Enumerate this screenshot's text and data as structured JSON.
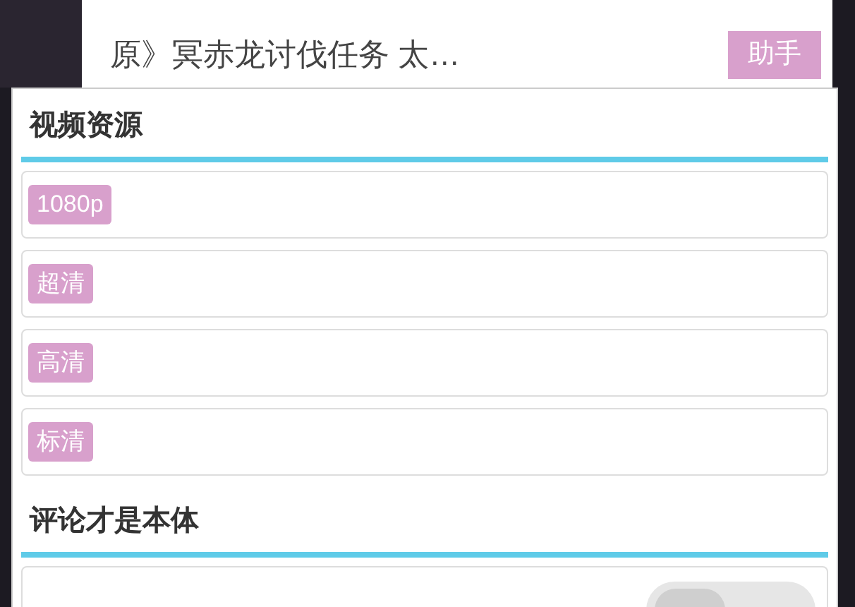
{
  "post": {
    "title": "原》冥赤龙讨伐任务  太…",
    "button": "助手"
  },
  "sections": [
    {
      "title": "视频资源",
      "items": [
        {
          "kind": "badge",
          "label": "1080p"
        },
        {
          "kind": "badge",
          "label": "超清"
        },
        {
          "kind": "badge",
          "label": "高清"
        },
        {
          "kind": "badge",
          "label": "标清"
        }
      ]
    },
    {
      "title": "评论才是本体",
      "items": [
        {
          "kind": "toggle",
          "on": false
        }
      ]
    }
  ]
}
